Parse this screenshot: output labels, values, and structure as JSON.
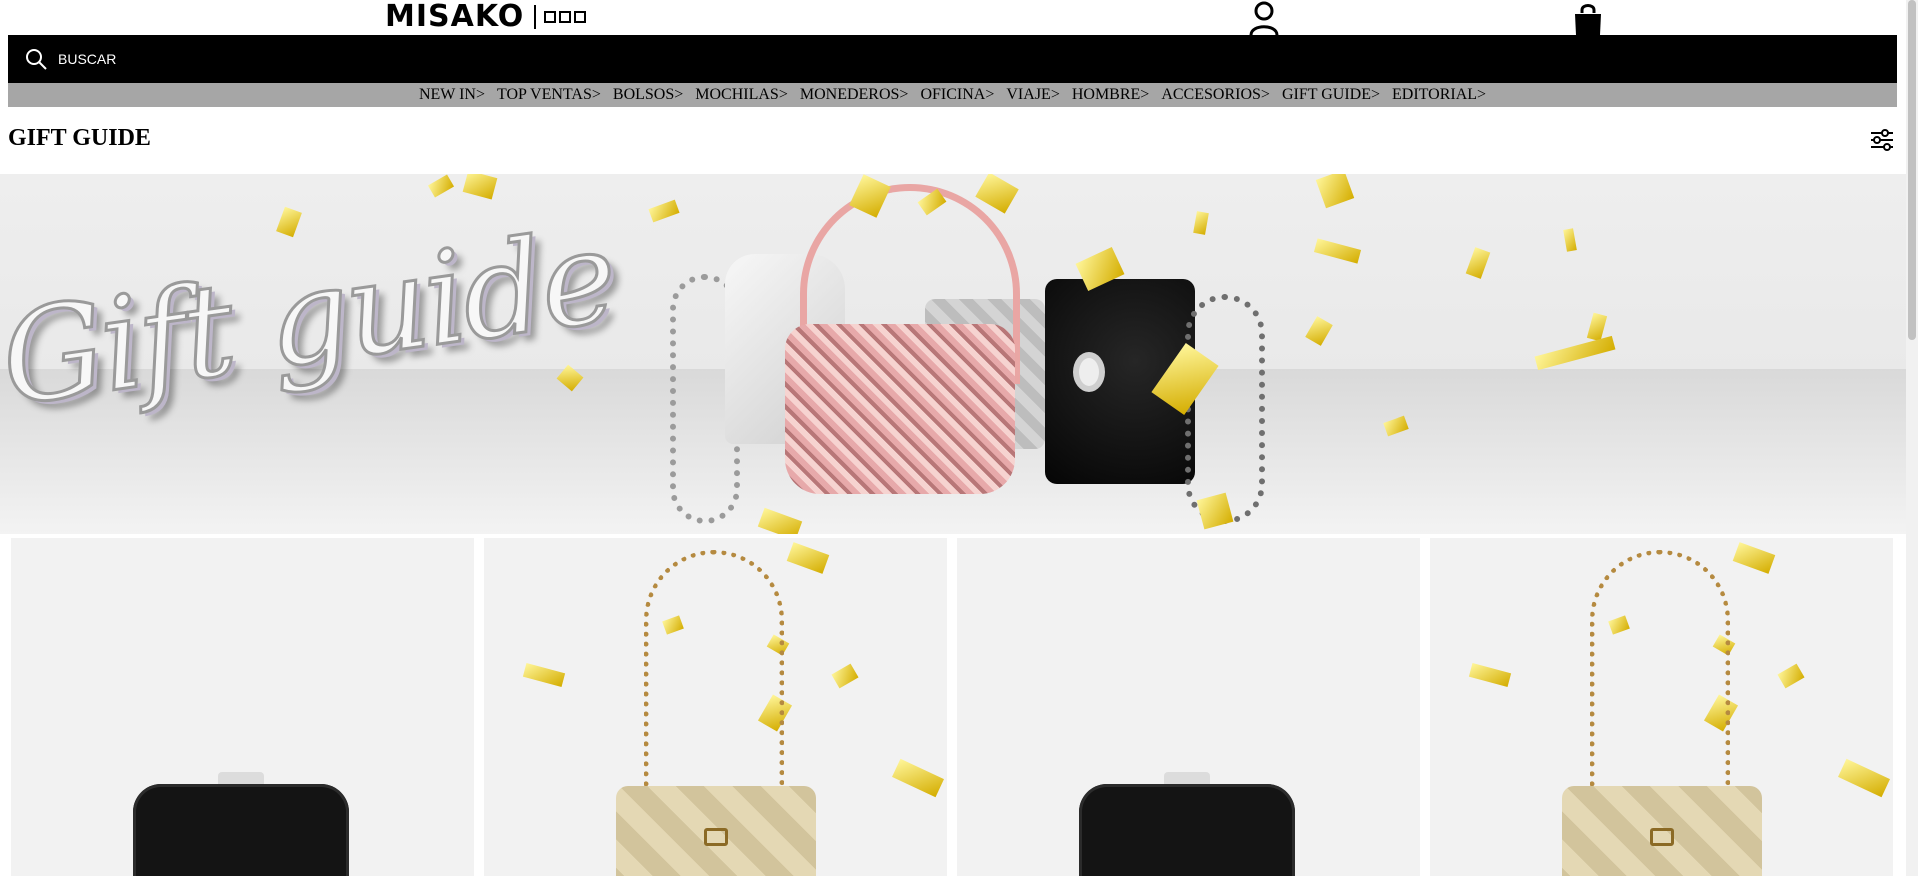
{
  "header": {
    "logo": "MISAKO",
    "search_placeholder": "BUSCAR"
  },
  "nav": {
    "items": [
      "NEW IN>",
      "TOP VENTAS>",
      "BOLSOS>",
      "MOCHILAS>",
      "MONEDEROS>",
      "OFICINA>",
      "VIAJE>",
      "HOMBRE>",
      "ACCESORIOS>",
      "GIFT GUIDE>",
      "EDITORIAL>"
    ]
  },
  "page": {
    "title": "GIFT GUIDE"
  },
  "hero": {
    "script_text": "Gift guide"
  },
  "icons": {
    "search": "search-icon",
    "user": "user-icon",
    "cart": "shopping-bag-icon",
    "filter": "filter-sliders-icon"
  },
  "colors": {
    "search_bar": "#000000",
    "nav_bar": "#a6a6a6",
    "confetti_gold": "#e3c000"
  }
}
